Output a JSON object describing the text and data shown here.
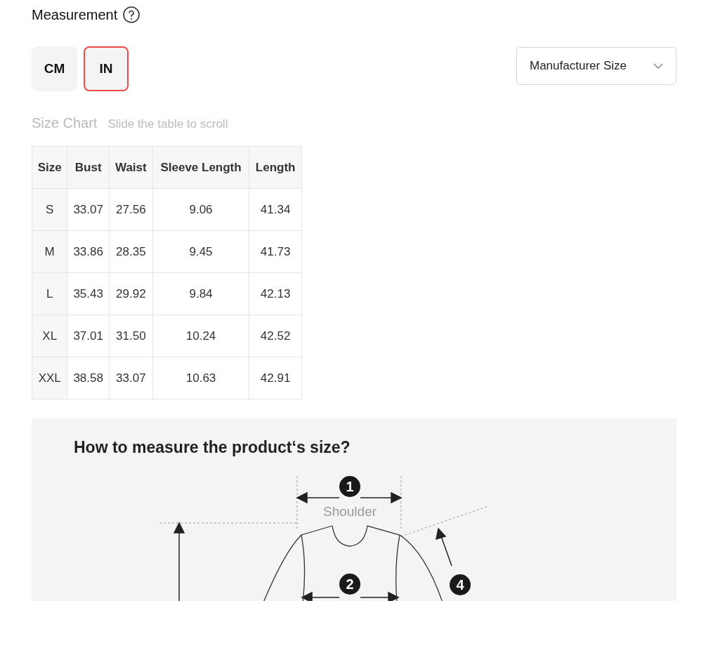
{
  "measurement": {
    "title": "Measurement"
  },
  "units": [
    {
      "label": "CM",
      "selected": false
    },
    {
      "label": "IN",
      "selected": true
    }
  ],
  "size_dropdown": {
    "value": "Manufacturer Size"
  },
  "size_chart": {
    "title": "Size Chart",
    "hint": "Slide the table to scroll"
  },
  "table": {
    "columns": [
      "Size",
      "Bust",
      "Waist",
      "Sleeve Length",
      "Length"
    ],
    "rows": [
      [
        "S",
        "33.07",
        "27.56",
        "9.06",
        "41.34"
      ],
      [
        "M",
        "33.86",
        "28.35",
        "9.45",
        "41.73"
      ],
      [
        "L",
        "35.43",
        "29.92",
        "9.84",
        "42.13"
      ],
      [
        "XL",
        "37.01",
        "31.50",
        "10.24",
        "42.52"
      ],
      [
        "XXL",
        "38.58",
        "33.07",
        "10.63",
        "42.91"
      ]
    ]
  },
  "guide": {
    "title": "How to measure the product‘s size?",
    "shoulder_label": "Shoulder",
    "markers": [
      "1",
      "2",
      "4"
    ]
  }
}
